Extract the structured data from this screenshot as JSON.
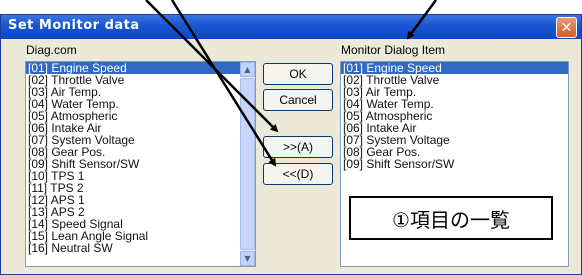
{
  "window": {
    "title": "Set Monitor data"
  },
  "left_list": {
    "label": "Diag.com",
    "items": [
      "[01] Engine Speed",
      "[02] Throttle Valve",
      "[03] Air Temp.",
      "[04] Water Temp.",
      "[05] Atmospheric",
      "[06] Intake Air",
      "[07] System Voltage",
      "[08] Gear Pos.",
      "[09] Shift Sensor/SW",
      "[10] TPS 1",
      "[11] TPS 2",
      "[12] APS 1",
      "[13] APS 2",
      "[14] Speed Signal",
      "[15] Lean Angle Signal",
      "[16] Neutral SW"
    ],
    "selected_index": 0
  },
  "right_list": {
    "label": "Monitor Dialog Item",
    "items": [
      "[01] Engine Speed",
      "[02] Throttle Valve",
      "[03] Air Temp.",
      "[04] Water Temp.",
      "[05] Atmospheric",
      "[06] Intake Air",
      "[07] System Voltage",
      "[08] Gear Pos.",
      "[09] Shift Sensor/SW"
    ],
    "selected_index": 0
  },
  "buttons": {
    "ok": "OK",
    "cancel": "Cancel",
    "add": ">>(A)",
    "remove": "<<(D)"
  },
  "annotation": {
    "text": "①項目の一覧"
  },
  "colors": {
    "title_bar": "#0a46c6",
    "selection": "#3169c6",
    "dialog_bg": "#ece9d8"
  }
}
